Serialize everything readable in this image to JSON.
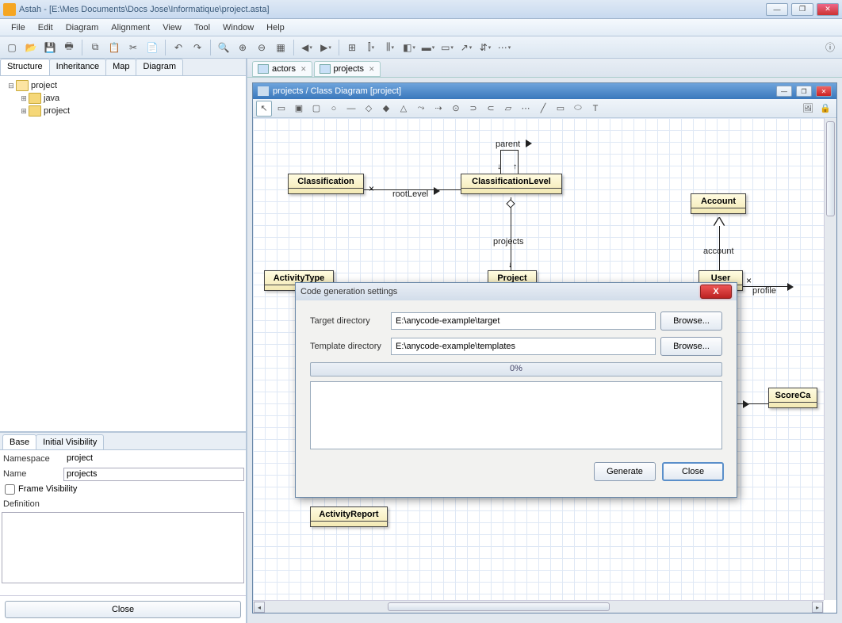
{
  "titlebar": {
    "app": "Astah",
    "path": "[E:\\Mes Documents\\Docs Jose\\Informatique\\project.asta]"
  },
  "menu": [
    "File",
    "Edit",
    "Diagram",
    "Alignment",
    "View",
    "Tool",
    "Window",
    "Help"
  ],
  "left_tabs": [
    "Structure",
    "Inheritance",
    "Map",
    "Diagram"
  ],
  "tree": {
    "root": "project",
    "children": [
      "java",
      "project"
    ]
  },
  "props_tabs": [
    "Base",
    "Initial Visibility"
  ],
  "props": {
    "namespace_label": "Namespace",
    "namespace_value": "project",
    "name_label": "Name",
    "name_value": "projects",
    "framevis_label": "Frame Visibility",
    "definition_label": "Definition"
  },
  "close_button": "Close",
  "doc_tabs": [
    {
      "label": "actors"
    },
    {
      "label": "projects"
    }
  ],
  "diagram_window_title": "projects / Class Diagram [project]",
  "uml": {
    "classification": "Classification",
    "classification_level": "ClassificationLevel",
    "account": "Account",
    "activity_type": "ActivityType",
    "project": "Project",
    "user": "User",
    "scorecard": "ScoreCa",
    "activity_report": "ActivityReport",
    "parent": "parent",
    "rootlevel": "rootLevel",
    "projects": "projects",
    "account_lbl": "account",
    "profile": "profile"
  },
  "dialog": {
    "title": "Code generation settings",
    "target_label": "Target directory",
    "target_value": "E:\\anycode-example\\target",
    "template_label": "Template directory",
    "template_value": "E:\\anycode-example\\templates",
    "browse": "Browse...",
    "progress": "0%",
    "generate": "Generate",
    "close": "Close"
  }
}
